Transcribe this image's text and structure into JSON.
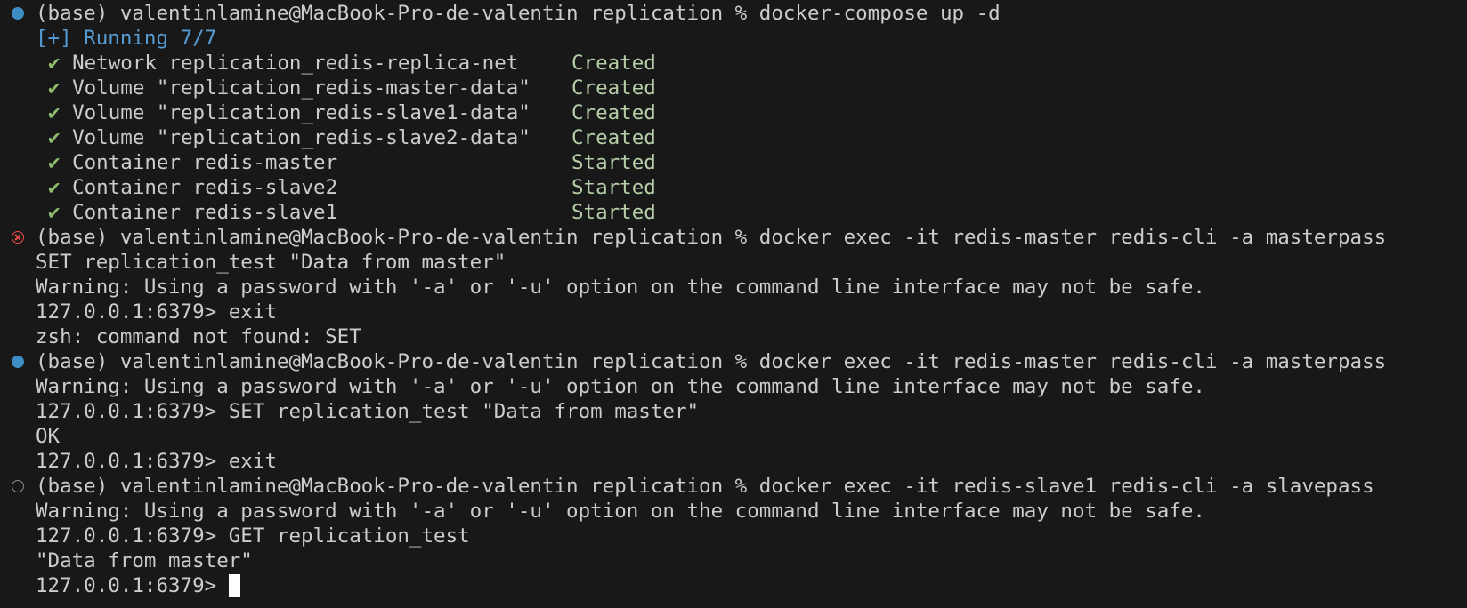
{
  "terminal": {
    "lines": [
      {
        "deco": "success",
        "text": "(base) valentinlamine@MacBook-Pro-de-valentin replication % docker-compose up -d"
      },
      {
        "text": "[+] Running 7/7",
        "style": "run"
      },
      {
        "check": "✔",
        "text": "Network replication_redis-replica-net",
        "status": "Created"
      },
      {
        "check": "✔",
        "text": "Volume \"replication_redis-master-data\"",
        "status": "Created"
      },
      {
        "check": "✔",
        "text": "Volume \"replication_redis-slave1-data\"",
        "status": "Created"
      },
      {
        "check": "✔",
        "text": "Volume \"replication_redis-slave2-data\"",
        "status": "Created"
      },
      {
        "check": "✔",
        "text": "Container redis-master",
        "status": "Started"
      },
      {
        "check": "✔",
        "text": "Container redis-slave2",
        "status": "Started"
      },
      {
        "check": "✔",
        "text": "Container redis-slave1",
        "status": "Started"
      },
      {
        "deco": "error",
        "text": "(base) valentinlamine@MacBook-Pro-de-valentin replication % docker exec -it redis-master redis-cli -a masterpass"
      },
      {
        "text": "SET replication_test \"Data from master\""
      },
      {
        "text": "Warning: Using a password with '-a' or '-u' option on the command line interface may not be safe."
      },
      {
        "text": "127.0.0.1:6379> exit"
      },
      {
        "text": "zsh: command not found: SET"
      },
      {
        "deco": "success",
        "text": "(base) valentinlamine@MacBook-Pro-de-valentin replication % docker exec -it redis-master redis-cli -a masterpass"
      },
      {
        "text": "Warning: Using a password with '-a' or '-u' option on the command line interface may not be safe."
      },
      {
        "text": "127.0.0.1:6379> SET replication_test \"Data from master\""
      },
      {
        "text": "OK"
      },
      {
        "text": "127.0.0.1:6379> exit"
      },
      {
        "deco": "default",
        "text": "(base) valentinlamine@MacBook-Pro-de-valentin replication % docker exec -it redis-slave1 redis-cli -a slavepass"
      },
      {
        "text": "Warning: Using a password with '-a' or '-u' option on the command line interface may not be safe."
      },
      {
        "text": "127.0.0.1:6379> GET replication_test"
      },
      {
        "text": "\"Data from master\""
      },
      {
        "text": "127.0.0.1:6379> ",
        "cursor": true
      }
    ]
  },
  "colors": {
    "background": "#181818",
    "foreground": "#cccccc",
    "running": "#569cd6",
    "check": "#8fbc6f",
    "status": "#b5cea8",
    "decoration_success": "#3d8ec4",
    "decoration_error": "#f14c4c",
    "decoration_default": "#8a8a8a"
  }
}
